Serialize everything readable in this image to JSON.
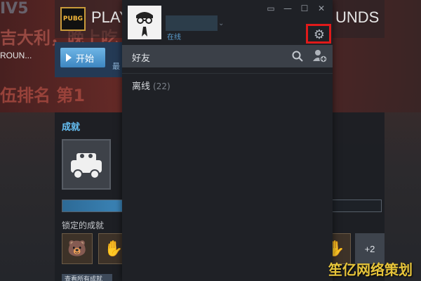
{
  "background": {
    "banner_top": "IV5",
    "banner_line1": "吉大利，晚上吃",
    "banner_line2": "伍排名 第1",
    "game_title_left": "PLAY",
    "game_title_right": "UNDS",
    "pubg_logo": "PUBG",
    "rounds_label": "ROUN...",
    "play_button_label": "开始",
    "play_side_text": "最",
    "achievements_title": "成就",
    "achievement_progress_fraction": 0.19,
    "locked_achievements_label": "锁定的成就",
    "more_badges_label": "+2",
    "view_all_label": "查看所有成就"
  },
  "friends_window": {
    "window_controls": [
      "▭",
      "—",
      "☐",
      "✕"
    ],
    "user_status": "在线",
    "friends_header": "好友",
    "groups": [
      {
        "name": "离线",
        "count": "(22)"
      }
    ],
    "icons": {
      "settings": "gear-icon",
      "search": "search-icon",
      "add_friend": "add-friend-icon"
    }
  },
  "watermark": "笙亿网络策划",
  "colors": {
    "accent": "#67c1f5",
    "status_online": "#5c9fd0",
    "highlight": "#e01a1a"
  }
}
